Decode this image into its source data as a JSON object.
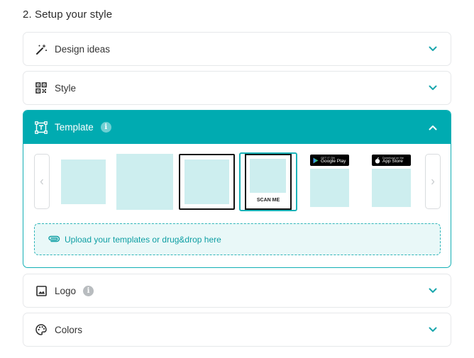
{
  "section": {
    "title": "2. Setup your style"
  },
  "accordions": {
    "design_ideas": {
      "label": "Design ideas",
      "icon": "magic-wand-icon",
      "expanded": false
    },
    "style": {
      "label": "Style",
      "icon": "qr-code-icon",
      "expanded": false
    },
    "template": {
      "label": "Template",
      "icon": "template-frame-icon",
      "info": "i",
      "expanded": true,
      "upload_label": "Upload your templates or drug&drop here",
      "tiles": [
        {
          "name": "plain"
        },
        {
          "name": "full-bleed"
        },
        {
          "name": "black-frame"
        },
        {
          "name": "scan-me-frame",
          "caption": "SCAN ME",
          "selected": true
        },
        {
          "name": "google-play",
          "badge_small": "GET IT ON",
          "badge_big": "Google Play"
        },
        {
          "name": "app-store",
          "badge_small": "Download on the",
          "badge_big": "App Store"
        }
      ]
    },
    "logo": {
      "label": "Logo",
      "icon": "image-icon",
      "info": "i",
      "expanded": false
    },
    "colors": {
      "label": "Colors",
      "icon": "palette-icon",
      "expanded": false
    }
  },
  "colors": {
    "accent": "#00abb1",
    "light_accent": "#cdeeef",
    "chevron": "#1aa6ad"
  }
}
